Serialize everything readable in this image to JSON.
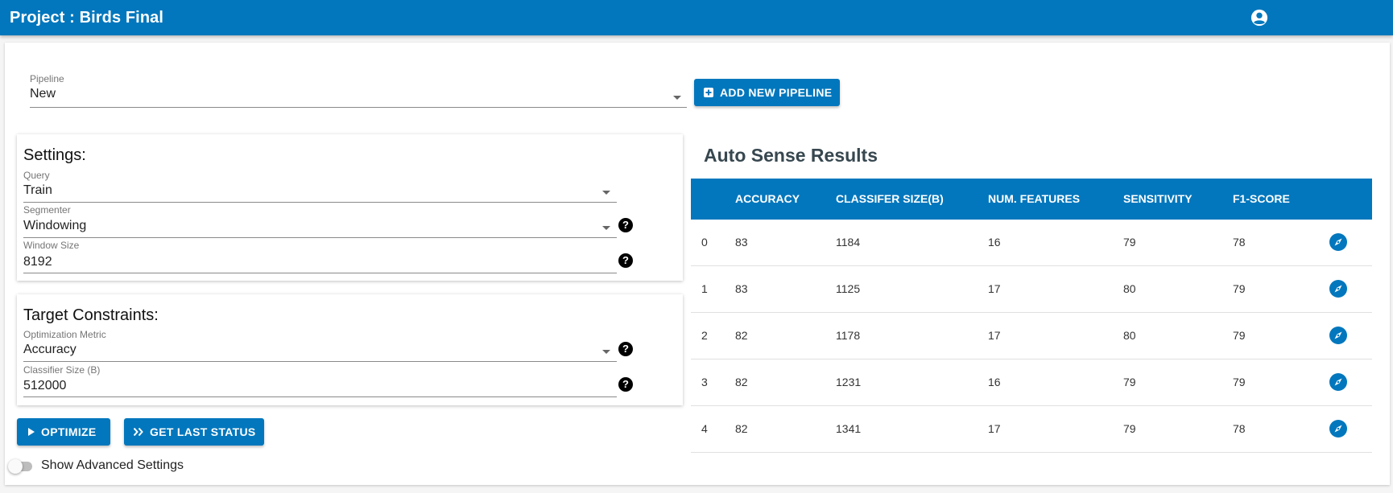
{
  "header": {
    "title": "Project : Birds Final",
    "account_icon": "account-circle-icon"
  },
  "pipeline": {
    "label": "Pipeline",
    "value": "New",
    "add_button_label": "ADD NEW PIPELINE"
  },
  "settings": {
    "title": "Settings:",
    "query": {
      "label": "Query",
      "value": "Train"
    },
    "segmenter": {
      "label": "Segmenter",
      "value": "Windowing"
    },
    "window_size": {
      "label": "Window Size",
      "value": "8192"
    }
  },
  "constraints": {
    "title": "Target Constraints:",
    "metric": {
      "label": "Optimization Metric",
      "value": "Accuracy"
    },
    "classifier_size": {
      "label": "Classifier Size (B)",
      "value": "512000"
    }
  },
  "actions": {
    "optimize_label": "OPTIMIZE",
    "last_status_label": "GET LAST STATUS"
  },
  "advanced_toggle": {
    "label": "Show Advanced Settings",
    "checked": false
  },
  "results": {
    "title": "Auto Sense Results",
    "columns": [
      "",
      "ACCURACY",
      "CLASSIFER SIZE(B)",
      "NUM. FEATURES",
      "SENSITIVITY",
      "F1-SCORE"
    ],
    "rows": [
      [
        "0",
        "83",
        "1184",
        "16",
        "79",
        "78"
      ],
      [
        "1",
        "83",
        "1125",
        "17",
        "80",
        "79"
      ],
      [
        "2",
        "82",
        "1178",
        "17",
        "80",
        "79"
      ],
      [
        "3",
        "82",
        "1231",
        "16",
        "79",
        "79"
      ],
      [
        "4",
        "82",
        "1341",
        "17",
        "79",
        "78"
      ]
    ],
    "row_action_icon": "compass-icon"
  },
  "colors": {
    "primary": "#0277bd",
    "results_title": "#37474f"
  }
}
